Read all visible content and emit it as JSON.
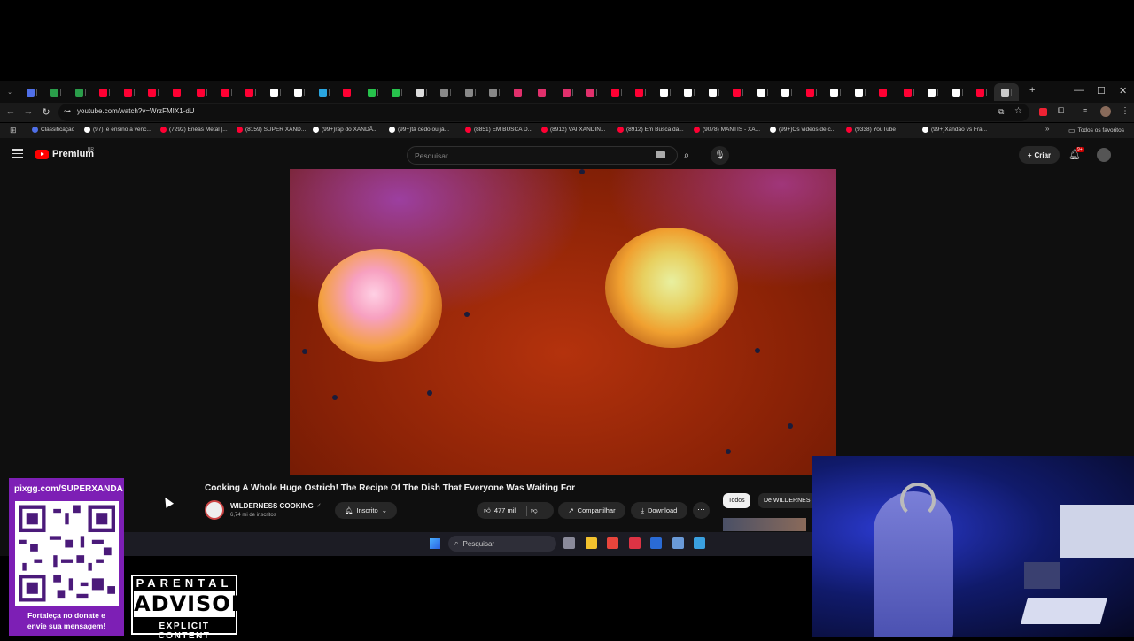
{
  "browser": {
    "url": "youtube.com/watch?v=WrzFMIX1-dU",
    "tab_favicon_colors": [
      "#4f6fe8",
      "#2a9d4a",
      "#2a9d4a",
      "#ff0033",
      "#ff0033",
      "#ff0033",
      "#ff0033",
      "#ff0033",
      "#ff0033",
      "#ff0033",
      "#ffffff",
      "#ffffff",
      "#2aa6e0",
      "#ff0033",
      "#27c24c",
      "#27c24c",
      "#dddddd",
      "#888888",
      "#888888",
      "#888888",
      "#e1306c",
      "#e1306c",
      "#e1306c",
      "#e1306c",
      "#ff0033",
      "#ff0033",
      "#ffffff",
      "#ffffff",
      "#ffffff",
      "#ff0033",
      "#ffffff",
      "#ffffff",
      "#ff0033",
      "#ffffff",
      "#ffffff",
      "#ff0033",
      "#ff0033",
      "#ffffff",
      "#ffffff",
      "#ff0033",
      "#cccccc"
    ],
    "bookmarks": [
      {
        "label": "Classificação",
        "color": "#4f6fe8"
      },
      {
        "label": "(97)Te ensino a venc...",
        "color": "#ffffff"
      },
      {
        "label": "(7292) Enéas Metal |...",
        "color": "#ff0033"
      },
      {
        "label": "(8159) SUPER XAND...",
        "color": "#ff0033"
      },
      {
        "label": "(99+)rap do XANDÃ...",
        "color": "#ffffff"
      },
      {
        "label": "(99+)tá cedo ou já...",
        "color": "#ffffff"
      },
      {
        "label": "(8851) EM BUSCA D...",
        "color": "#ff0033"
      },
      {
        "label": "(8912) VAI XANDIN...",
        "color": "#ff0033"
      },
      {
        "label": "(8912) Em Busca da...",
        "color": "#ff0033"
      },
      {
        "label": "(9078) MANTIS - XA...",
        "color": "#ff0033"
      },
      {
        "label": "(99+)Os vídeos de c...",
        "color": "#ffffff"
      },
      {
        "label": "(9338) YouTube",
        "color": "#ff0033"
      },
      {
        "label": "(99+)Xandão vs Fra...",
        "color": "#ffffff"
      }
    ],
    "all_bookmarks": "Todos os favoritos"
  },
  "youtube": {
    "logo": "Premium",
    "country": "BR",
    "search_placeholder": "Pesquisar",
    "create_label": "Criar",
    "notif_badge": "9+",
    "video_title": "Cooking A Whole Huge Ostrich! The Recipe Of The Dish That Everyone Was Waiting For",
    "channel_name": "WILDERNESS COOKING",
    "channel_subs": "6,74 mi de inscritos",
    "subscribe_label": "Inscrito",
    "likes": "477 mil",
    "share_label": "Compartilhar",
    "download_label": "Download",
    "chips": [
      "Todos",
      "De WILDERNES"
    ]
  },
  "taskbar": {
    "search_placeholder": "Pesquisar",
    "icon_colors": [
      "#8a8a9a",
      "#f2c12e",
      "#e8453c",
      "#d34",
      "#2a6bd6",
      "#6a9ad8",
      "#3aa0e0"
    ]
  },
  "overlay": {
    "donate_url": "pixgg.com/SUPERXANDA",
    "donate_line1": "Fortaleça no donate e",
    "donate_line2": "envie sua mensagem!",
    "advisory_top": "PARENTAL",
    "advisory_mid": "ADVISORY",
    "advisory_bottom": "EXPLICIT CONTENT"
  }
}
